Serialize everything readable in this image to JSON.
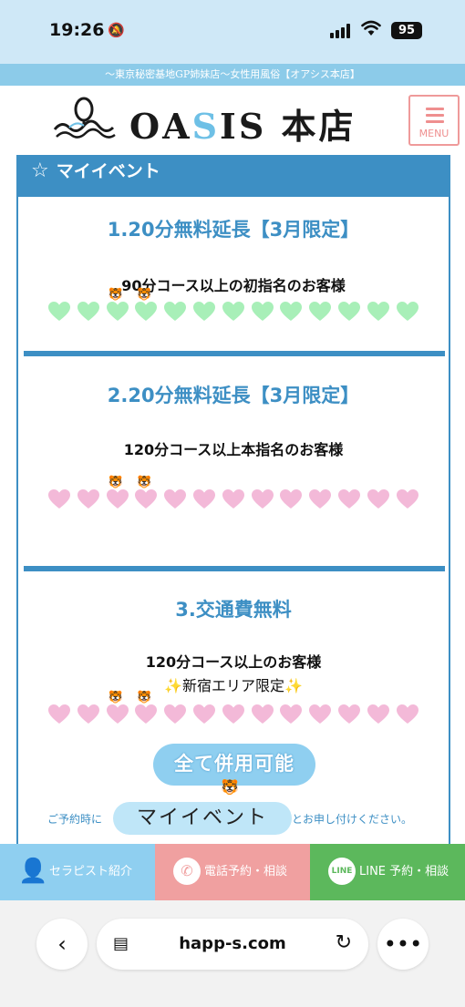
{
  "status_bar": {
    "time": "19:26",
    "battery": "95"
  },
  "tagline": "〜東京秘密基地GP姉妹店〜女性用風俗【オアシス本店】",
  "header": {
    "logo_text_pre": "OA",
    "logo_text_hl": "S",
    "logo_text_post": "IS 本店",
    "menu_label": "MENU"
  },
  "section": {
    "title": "マイイベント"
  },
  "events": [
    {
      "title": "1.20分無料延長【3月限定】",
      "condition": "90分コース以上の初指名のお客様",
      "sub": "",
      "heart_color": "#a8efb8"
    },
    {
      "title": "2.20分無料延長【3月限定】",
      "condition": "120分コース以上本指名のお客様",
      "sub": "",
      "heart_color": "#f3b9d8"
    },
    {
      "title": "3.交通費無料",
      "condition": "120分コース以上のお客様",
      "sub": "✨新宿エリア限定✨",
      "heart_color": "#f3b9d8"
    }
  ],
  "combo_label": "全て併用可能",
  "notice": {
    "pre": "ご予約時に",
    "highlight": "マイイベント",
    "post": "とお申し付けください。"
  },
  "action_bar": {
    "therapist": "セラピスト紹介",
    "phone": "電話予約・相談",
    "line": "LINE 予約・相談",
    "line_icon_text": "LINE"
  },
  "browser": {
    "url": "happ-s.com"
  }
}
